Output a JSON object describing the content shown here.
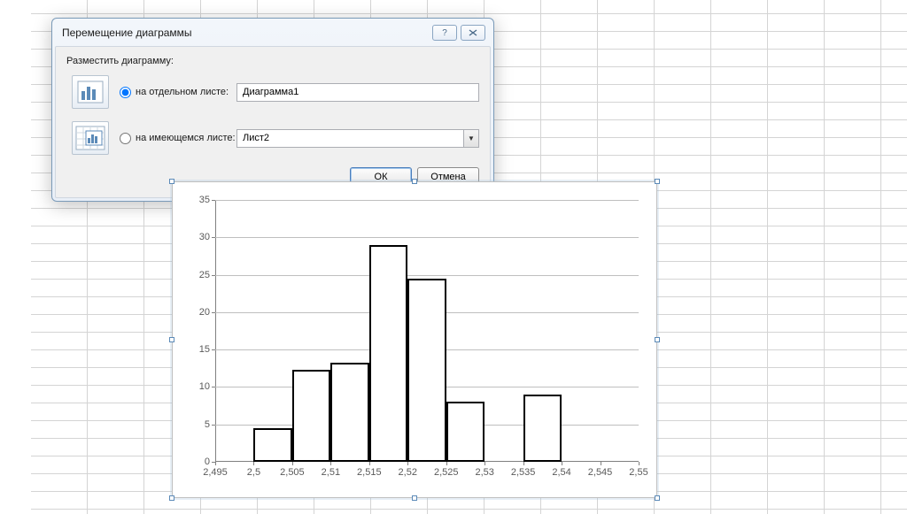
{
  "dialog": {
    "title": "Перемещение диаграммы",
    "section_label": "Разместить диаграмму:",
    "option1": {
      "label": "на отдельном листе:",
      "value": "Диаграмма1"
    },
    "option2": {
      "label": "на имеющемся листе:",
      "value": "Лист2"
    },
    "ok_label": "ОК",
    "cancel_label": "Отмена"
  },
  "chart_data": {
    "type": "bar",
    "x_ticks": [
      "2,495",
      "2,5",
      "2,505",
      "2,51",
      "2,515",
      "2,52",
      "2,525",
      "2,53",
      "2,535",
      "2,54",
      "2,545",
      "2,55"
    ],
    "y_ticks": [
      0,
      5,
      10,
      15,
      20,
      25,
      30,
      35
    ],
    "ylim": [
      0,
      35
    ],
    "xlim": [
      2.495,
      2.55
    ],
    "bars": [
      {
        "x0": 2.5,
        "x1": 2.505,
        "value": 4.5
      },
      {
        "x0": 2.505,
        "x1": 2.51,
        "value": 12.3
      },
      {
        "x0": 2.51,
        "x1": 2.515,
        "value": 13.3
      },
      {
        "x0": 2.515,
        "x1": 2.52,
        "value": 29
      },
      {
        "x0": 2.52,
        "x1": 2.525,
        "value": 24.5
      },
      {
        "x0": 2.525,
        "x1": 2.53,
        "value": 8
      },
      {
        "x0": 2.535,
        "x1": 2.54,
        "value": 9
      }
    ],
    "title": "",
    "xlabel": "",
    "ylabel": ""
  }
}
